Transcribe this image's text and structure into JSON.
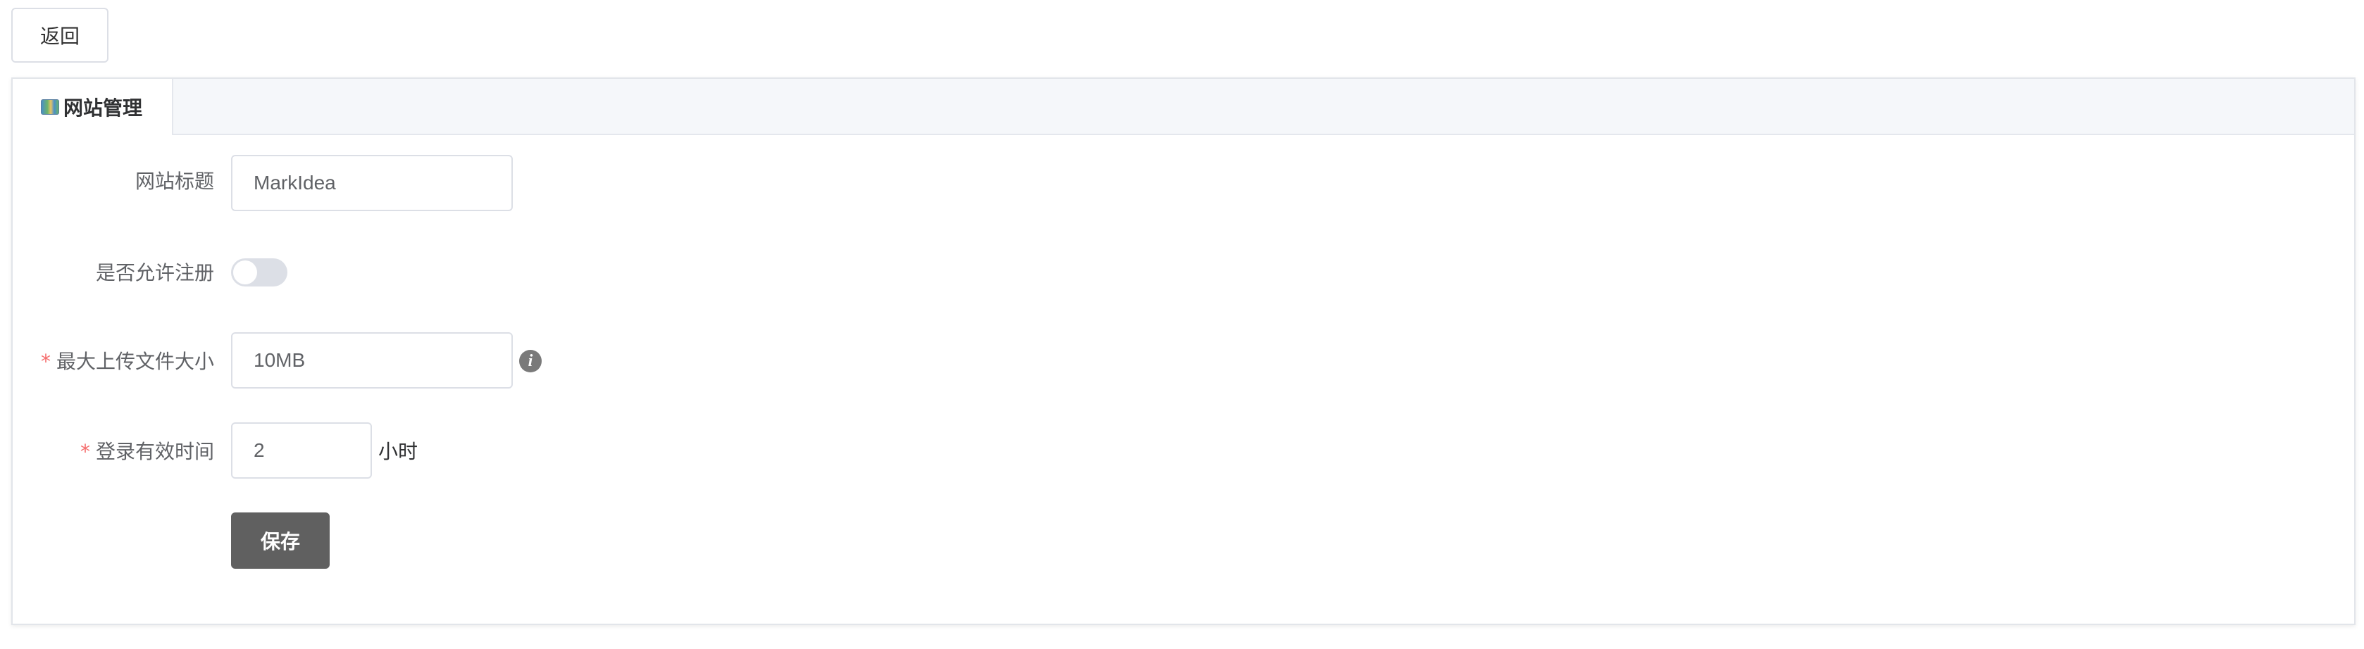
{
  "toolbar": {
    "back_label": "返回"
  },
  "tabs": [
    {
      "label": "网站管理",
      "icon": "map-icon",
      "active": true
    }
  ],
  "form": {
    "site_title": {
      "label": "网站标题",
      "value": "MarkIdea",
      "required": false
    },
    "allow_register": {
      "label": "是否允许注册",
      "enabled": false
    },
    "max_upload_size": {
      "label": "最大上传文件大小",
      "value": "10MB",
      "required": true,
      "help_icon": "info-icon"
    },
    "login_valid_time": {
      "label": "登录有效时间",
      "value": "2",
      "unit": "小时",
      "required": true
    },
    "required_mark": "*",
    "save_label": "保存"
  },
  "colors": {
    "required": "#f56c6c",
    "save_button": "#606060",
    "toggle_off": "#dcdfe6"
  }
}
